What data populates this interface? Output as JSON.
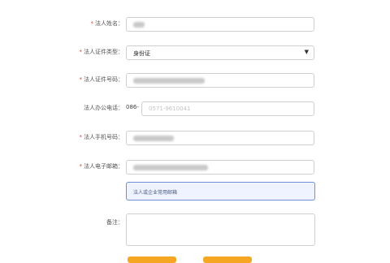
{
  "form": {
    "legal_name": {
      "label": "法人姓名：",
      "required": true
    },
    "id_type": {
      "label": "法人证件类型：",
      "required": true,
      "value": "身份证"
    },
    "id_number": {
      "label": "法人证件号码：",
      "required": true
    },
    "office_phone": {
      "label": "法人办公电话：",
      "required": false,
      "prefix": "086-",
      "placeholder": "0571-9610041"
    },
    "mobile": {
      "label": "法人手机号码：",
      "required": true
    },
    "email": {
      "label": "法人电子邮箱：",
      "required": true,
      "hint": "法人或企业常用邮箱"
    },
    "remark": {
      "label": "备注：",
      "required": false
    }
  },
  "colors": {
    "required_mark": "#e23b3b",
    "hint_border": "#6f8fd6",
    "hint_bg": "#eef3ff",
    "button": "#f5a623"
  }
}
